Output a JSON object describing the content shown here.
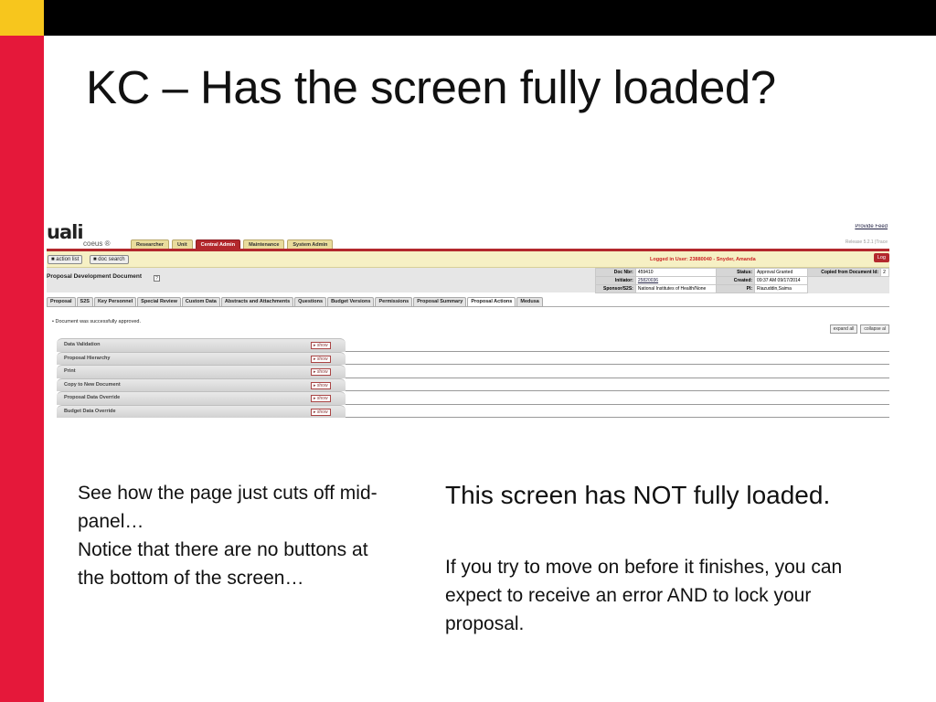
{
  "slide": {
    "title": "KC – Has the screen fully loaded?",
    "left_note_1": "See how the page just cuts off mid-panel…",
    "left_note_2": "Notice that there are no buttons at the bottom of the screen…",
    "right_heading": "This screen has NOT fully loaded.",
    "right_body": "If you try to move on before it finishes, you can expect to receive an error AND to lock your proposal."
  },
  "colors": {
    "corner_yellow": "#f7c61d",
    "side_red": "#e5183a",
    "kc_red": "#b3282c"
  },
  "app": {
    "logo": "uali",
    "logo_sub": "coeus ®",
    "provide_feedback": "Provide Feed",
    "release": "Release 5.2.1 |Trace",
    "main_tabs": [
      "Researcher",
      "Unit",
      "Central Admin",
      "Maintenance",
      "System Admin"
    ],
    "active_main_tab": "Central Admin",
    "action_list": "action list",
    "doc_search": "doc search",
    "logged_in": "Logged in User: 23880040 - Snyder, Amanda",
    "logout": "Log",
    "doc_title": "Proposal Development Document",
    "help": "?",
    "doc_info": {
      "doc_nbr_label": "Doc Nbr:",
      "doc_nbr": "459410",
      "status_label": "Status:",
      "status": "Approval Granted",
      "copied_label": "Copied from Document Id:",
      "copied_val": "2",
      "initiator_label": "Initiator:",
      "initiator": "25820036",
      "created_label": "Created:",
      "created": "09:37 AM 09/17/2014",
      "sponsor_label": "Sponsor/S2S:",
      "sponsor": "National Institutes of Health/None",
      "pi_label": "PI:",
      "pi": "Riazuddin,Saima"
    },
    "sub_tabs": [
      "Proposal",
      "S2S",
      "Key Personnel",
      "Special Review",
      "Custom Data",
      "Abstracts and Attachments",
      "Questions",
      "Budget Versions",
      "Permissions",
      "Proposal Summary",
      "Proposal Actions",
      "Medusa"
    ],
    "active_sub_tab": "Proposal Actions",
    "message": "Document was successfully approved.",
    "expand_all": "expand all",
    "collapse_all": "collapse al",
    "show_label": "show",
    "panels": [
      "Data Validation",
      "Proposal Hierarchy",
      "Print",
      "Copy to New Document",
      "Proposal Data Override",
      "Budget Data Override"
    ]
  }
}
